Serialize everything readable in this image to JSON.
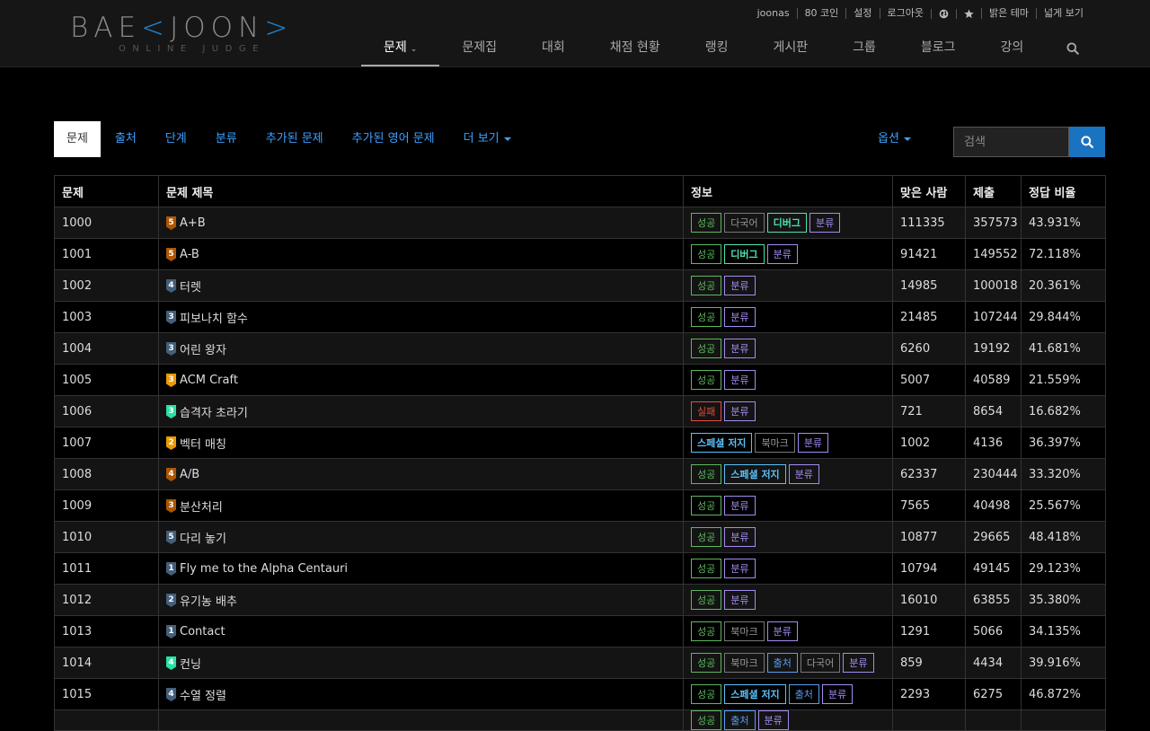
{
  "brand": {
    "logo_text": "BAE",
    "logo_text_mid": "JOON",
    "logo_sub": "ONLINE JUDGE"
  },
  "topbar": {
    "username": "joonas",
    "coins": "80 코인",
    "settings": "설정",
    "logout": "로그아웃",
    "language_icon": "globe-icon",
    "favorite_icon": "star-icon",
    "theme": "밝은 테마",
    "wide": "넓게 보기"
  },
  "nav": {
    "items": [
      "문제",
      "문제집",
      "대회",
      "채점 현황",
      "랭킹",
      "게시판",
      "그룹",
      "블로그",
      "강의"
    ],
    "active_index": 0,
    "search_icon": "search-icon"
  },
  "tabs": {
    "items": [
      "문제",
      "출처",
      "단계",
      "분류",
      "추가된 문제",
      "추가된 영어 문제",
      "더 보기"
    ],
    "active_index": 0
  },
  "options_label": "옵션",
  "search": {
    "placeholder": "검색",
    "value": ""
  },
  "colors": {
    "link": "#3ea1ff",
    "success": "#5cb85c",
    "fail": "#e74c3c",
    "category": "#a48bf0",
    "special": "#5bc0f8",
    "debug": "#4fe0b0",
    "tier_bronze": "#ad5600",
    "tier_silver": "#435f7a",
    "tier_gold": "#ec9a00",
    "tier_platinum": "#27e2a4"
  },
  "table": {
    "headers": [
      "문제",
      "문제 제목",
      "정보",
      "맞은 사람",
      "제출",
      "정답 비율"
    ],
    "rows": [
      {
        "id": "1000",
        "title": "A+B",
        "tier": "bronze",
        "level": "5",
        "labels": [
          [
            "성공",
            "success"
          ],
          [
            "다국어",
            "multi"
          ],
          [
            "디버그",
            "debug"
          ],
          [
            "분류",
            "category"
          ]
        ],
        "solved": "111335",
        "submissions": "357573",
        "ratio": "43.931%"
      },
      {
        "id": "1001",
        "title": "A-B",
        "tier": "bronze",
        "level": "5",
        "labels": [
          [
            "성공",
            "success"
          ],
          [
            "디버그",
            "debug"
          ],
          [
            "분류",
            "category"
          ]
        ],
        "solved": "91421",
        "submissions": "149552",
        "ratio": "72.118%"
      },
      {
        "id": "1002",
        "title": "터렛",
        "tier": "silver",
        "level": "4",
        "labels": [
          [
            "성공",
            "success"
          ],
          [
            "분류",
            "category"
          ]
        ],
        "solved": "14985",
        "submissions": "100018",
        "ratio": "20.361%"
      },
      {
        "id": "1003",
        "title": "피보나치 함수",
        "tier": "silver",
        "level": "3",
        "labels": [
          [
            "성공",
            "success"
          ],
          [
            "분류",
            "category"
          ]
        ],
        "solved": "21485",
        "submissions": "107244",
        "ratio": "29.844%"
      },
      {
        "id": "1004",
        "title": "어린 왕자",
        "tier": "silver",
        "level": "3",
        "labels": [
          [
            "성공",
            "success"
          ],
          [
            "분류",
            "category"
          ]
        ],
        "solved": "6260",
        "submissions": "19192",
        "ratio": "41.681%"
      },
      {
        "id": "1005",
        "title": "ACM Craft",
        "tier": "gold",
        "level": "3",
        "labels": [
          [
            "성공",
            "success"
          ],
          [
            "분류",
            "category"
          ]
        ],
        "solved": "5007",
        "submissions": "40589",
        "ratio": "21.559%"
      },
      {
        "id": "1006",
        "title": "습격자 초라기",
        "tier": "platinum",
        "level": "3",
        "labels": [
          [
            "실패",
            "fail"
          ],
          [
            "분류",
            "category"
          ]
        ],
        "solved": "721",
        "submissions": "8654",
        "ratio": "16.682%"
      },
      {
        "id": "1007",
        "title": "벡터 매칭",
        "tier": "gold",
        "level": "2",
        "labels": [
          [
            "스페셜 저지",
            "special"
          ],
          [
            "북마크",
            "bookmark"
          ],
          [
            "분류",
            "category"
          ]
        ],
        "solved": "1002",
        "submissions": "4136",
        "ratio": "36.397%"
      },
      {
        "id": "1008",
        "title": "A/B",
        "tier": "bronze",
        "level": "4",
        "labels": [
          [
            "성공",
            "success"
          ],
          [
            "스페셜 저지",
            "special"
          ],
          [
            "분류",
            "category"
          ]
        ],
        "solved": "62337",
        "submissions": "230444",
        "ratio": "33.320%"
      },
      {
        "id": "1009",
        "title": "분산처리",
        "tier": "bronze",
        "level": "3",
        "labels": [
          [
            "성공",
            "success"
          ],
          [
            "분류",
            "category"
          ]
        ],
        "solved": "7565",
        "submissions": "40498",
        "ratio": "25.567%"
      },
      {
        "id": "1010",
        "title": "다리 놓기",
        "tier": "silver",
        "level": "5",
        "labels": [
          [
            "성공",
            "success"
          ],
          [
            "분류",
            "category"
          ]
        ],
        "solved": "10877",
        "submissions": "29665",
        "ratio": "48.418%"
      },
      {
        "id": "1011",
        "title": "Fly me to the Alpha Centauri",
        "tier": "silver",
        "level": "1",
        "labels": [
          [
            "성공",
            "success"
          ],
          [
            "분류",
            "category"
          ]
        ],
        "solved": "10794",
        "submissions": "49145",
        "ratio": "29.123%"
      },
      {
        "id": "1012",
        "title": "유기농 배추",
        "tier": "silver",
        "level": "2",
        "labels": [
          [
            "성공",
            "success"
          ],
          [
            "분류",
            "category"
          ]
        ],
        "solved": "16010",
        "submissions": "63855",
        "ratio": "35.380%"
      },
      {
        "id": "1013",
        "title": "Contact",
        "tier": "silver",
        "level": "1",
        "labels": [
          [
            "성공",
            "success"
          ],
          [
            "북마크",
            "bookmark"
          ],
          [
            "분류",
            "category"
          ]
        ],
        "solved": "1291",
        "submissions": "5066",
        "ratio": "34.135%"
      },
      {
        "id": "1014",
        "title": "컨닝",
        "tier": "platinum",
        "level": "4",
        "labels": [
          [
            "성공",
            "success"
          ],
          [
            "북마크",
            "bookmark"
          ],
          [
            "출처",
            "source"
          ],
          [
            "다국어",
            "multi"
          ],
          [
            "분류",
            "category"
          ]
        ],
        "solved": "859",
        "submissions": "4434",
        "ratio": "39.916%"
      },
      {
        "id": "1015",
        "title": "수열 정렬",
        "tier": "silver",
        "level": "4",
        "labels": [
          [
            "성공",
            "success"
          ],
          [
            "스페셜 저지",
            "special"
          ],
          [
            "출처",
            "source"
          ],
          [
            "분류",
            "category"
          ]
        ],
        "solved": "2293",
        "submissions": "6275",
        "ratio": "46.872%"
      }
    ],
    "partial_row_labels": [
      [
        "성공",
        "success"
      ],
      [
        "출처",
        "source"
      ],
      [
        "분류",
        "category"
      ]
    ]
  }
}
